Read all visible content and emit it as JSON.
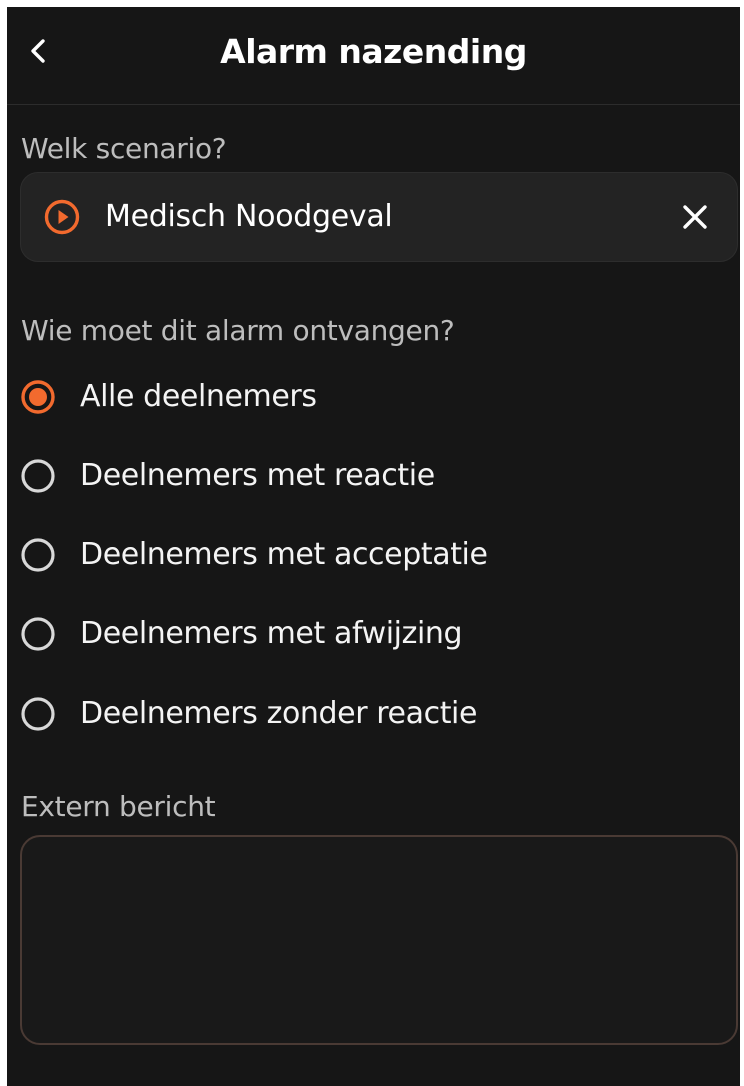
{
  "header": {
    "title": "Alarm nazending",
    "back_icon": "chevron-left-icon"
  },
  "scenario": {
    "label": "Welk scenario?",
    "selected": "Medisch Noodgeval",
    "icon": "play-circle-icon",
    "clear_icon": "close-icon"
  },
  "recipients": {
    "label": "Wie moet dit alarm ontvangen?",
    "selected_index": 0,
    "options": [
      "Alle deelnemers",
      "Deelnemers met reactie",
      "Deelnemers met acceptatie",
      "Deelnemers met afwijzing",
      "Deelnemers zonder reactie"
    ]
  },
  "message": {
    "label": "Extern bericht",
    "value": ""
  },
  "colors": {
    "accent": "#f26a2e",
    "background": "#161616",
    "card": "#232323",
    "label": "#bdbdbd",
    "radio_unselected": "#d8d8d8",
    "message_border": "#4a3a34"
  }
}
